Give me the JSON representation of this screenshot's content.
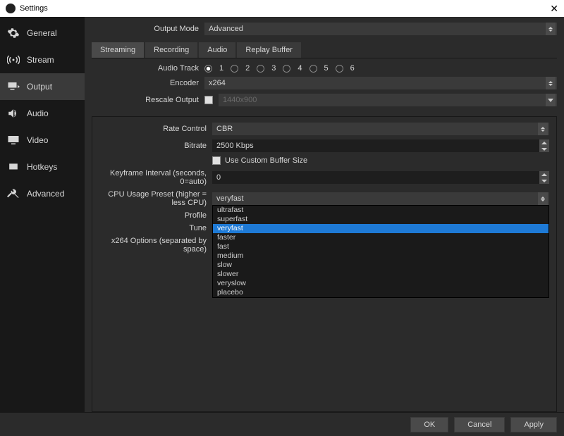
{
  "window": {
    "title": "Settings"
  },
  "sidebar": {
    "items": [
      {
        "label": "General"
      },
      {
        "label": "Stream"
      },
      {
        "label": "Output"
      },
      {
        "label": "Audio"
      },
      {
        "label": "Video"
      },
      {
        "label": "Hotkeys"
      },
      {
        "label": "Advanced"
      }
    ],
    "active_index": 2
  },
  "output_mode": {
    "label": "Output Mode",
    "value": "Advanced"
  },
  "tabs": {
    "items": [
      {
        "label": "Streaming"
      },
      {
        "label": "Recording"
      },
      {
        "label": "Audio"
      },
      {
        "label": "Replay Buffer"
      }
    ],
    "active_index": 0
  },
  "audio_track": {
    "label": "Audio Track",
    "options": [
      "1",
      "2",
      "3",
      "4",
      "5",
      "6"
    ],
    "selected_index": 0
  },
  "encoder": {
    "label": "Encoder",
    "value": "x264"
  },
  "rescale": {
    "label": "Rescale Output",
    "checked": false,
    "value": "1440x900"
  },
  "rate_control": {
    "label": "Rate Control",
    "value": "CBR"
  },
  "bitrate": {
    "label": "Bitrate",
    "value": "2500 Kbps"
  },
  "custom_buffer": {
    "checked": false,
    "label": "Use Custom Buffer Size"
  },
  "keyframe": {
    "label": "Keyframe Interval (seconds, 0=auto)",
    "value": "0"
  },
  "cpu_preset": {
    "label": "CPU Usage Preset (higher = less CPU)",
    "value": "veryfast",
    "options": [
      "ultrafast",
      "superfast",
      "veryfast",
      "faster",
      "fast",
      "medium",
      "slow",
      "slower",
      "veryslow",
      "placebo"
    ],
    "highlight_index": 2
  },
  "profile": {
    "label": "Profile"
  },
  "tune": {
    "label": "Tune"
  },
  "x264_options": {
    "label": "x264 Options (separated by space)"
  },
  "buttons": {
    "ok": "OK",
    "cancel": "Cancel",
    "apply": "Apply"
  }
}
